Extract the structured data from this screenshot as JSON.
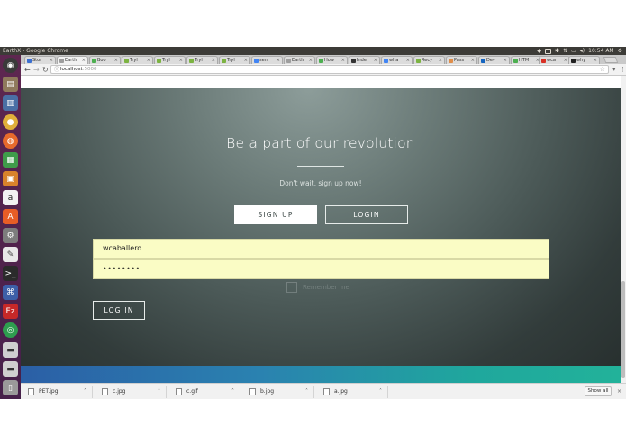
{
  "system": {
    "window_title": "EarthX - Google Chrome",
    "clock": "10:54 AM"
  },
  "browser": {
    "tabs": [
      {
        "label": "Stor",
        "color": "#3b6fd1",
        "active": false
      },
      {
        "label": "Earth",
        "color": "#9e9e9e",
        "active": true
      },
      {
        "label": "Boo",
        "color": "#4caf50",
        "active": false
      },
      {
        "label": "Tryl",
        "color": "#7cb342",
        "active": false
      },
      {
        "label": "Tryl",
        "color": "#7cb342",
        "active": false
      },
      {
        "label": "Tryl",
        "color": "#7cb342",
        "active": false
      },
      {
        "label": "Tryl",
        "color": "#7cb342",
        "active": false
      },
      {
        "label": "sen",
        "color": "#4285f4",
        "active": false
      },
      {
        "label": "Earth",
        "color": "#9e9e9e",
        "active": false
      },
      {
        "label": "How",
        "color": "#4caf50",
        "active": false
      },
      {
        "label": "Inde",
        "color": "#333333",
        "active": false
      },
      {
        "label": "wha",
        "color": "#4285f4",
        "active": false
      },
      {
        "label": "Recy",
        "color": "#7cb342",
        "active": false
      },
      {
        "label": "Pass",
        "color": "#e08e4a",
        "active": false
      },
      {
        "label": "Dev",
        "color": "#1565c0",
        "active": false
      },
      {
        "label": "HTM",
        "color": "#4caf50",
        "active": false
      },
      {
        "label": "wca",
        "color": "#d93025",
        "active": false
      },
      {
        "label": "why",
        "color": "#222222",
        "active": false
      }
    ],
    "url_host": "localhost",
    "url_port": ":5000"
  },
  "page": {
    "hero_title": "Be a part of our revolution",
    "hero_subtitle": "Don't wait, sign up now!",
    "signup_button": "SIGN UP",
    "login_button": "LOGIN",
    "username_value": "wcaballero",
    "password_value": "••••••••",
    "remember_label": "Remember me",
    "login_form_button": "LOG IN"
  },
  "downloads": {
    "items": [
      "PET.jpg",
      "c.jpg",
      "c.gif",
      "b.jpg",
      "a.jpg"
    ],
    "show_all": "Show all"
  }
}
